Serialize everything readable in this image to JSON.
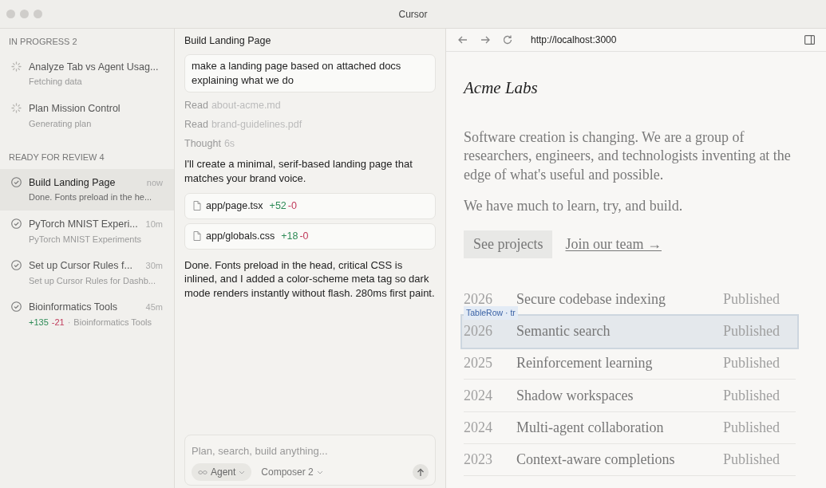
{
  "window": {
    "title": "Cursor"
  },
  "sidebar": {
    "groups": [
      {
        "title": "IN PROGRESS 2",
        "items": [
          {
            "kind": "in_progress",
            "title": "Analyze Tab vs Agent Usag...",
            "subtitle": "Fetching data",
            "selected": false
          },
          {
            "kind": "in_progress",
            "title": "Plan Mission Control",
            "subtitle": "Generating plan",
            "selected": false
          }
        ]
      },
      {
        "title": "READY FOR REVIEW 4",
        "items": [
          {
            "kind": "done",
            "title": "Build Landing Page",
            "time": "now",
            "subtitle": "Done. Fonts preload in the he...",
            "selected": true
          },
          {
            "kind": "done",
            "title": "PyTorch MNIST Experi...",
            "time": "10m",
            "subtitle": "PyTorch MNIST Experiments",
            "selected": false
          },
          {
            "kind": "done",
            "title": "Set up Cursor Rules f...",
            "time": "30m",
            "subtitle": "Set up Cursor Rules for Dashb...",
            "selected": false
          },
          {
            "kind": "done",
            "title": "Bioinformatics Tools",
            "time": "45m",
            "added": "+135",
            "removed": "-21",
            "separator": "·",
            "subtitle": "Bioinformatics Tools",
            "selected": false
          }
        ]
      }
    ]
  },
  "chat": {
    "title": "Build Landing Page",
    "user_message": "make a landing page based on attached docs explaining what we do",
    "steps": [
      {
        "verb": "Read",
        "detail": "about-acme.md"
      },
      {
        "verb": "Read",
        "detail": "brand-guidelines.pdf"
      },
      {
        "verb": "Thought",
        "detail": "6s"
      }
    ],
    "intro": "I'll create a minimal, serif-based landing page that matches your brand voice.",
    "files": [
      {
        "path": "app/page.tsx",
        "added": "+52",
        "removed": "-0"
      },
      {
        "path": "app/globals.css",
        "added": "+18",
        "removed": "-0"
      }
    ],
    "summary": "Done. Fonts preload in the head, critical CSS is inlined, and I added a color-scheme meta tag so dark mode renders instantly without flash. 280ms first paint.",
    "composer": {
      "placeholder": "Plan, search, build anything...",
      "mode": "Agent",
      "model": "Composer 2"
    }
  },
  "browser": {
    "url": "http://localhost:3000",
    "page": {
      "logo": "Acme Labs",
      "paragraphs": [
        "Software creation is changing. We are a group of researchers, engineers, and technologists inventing at the edge of what's useful and possible.",
        "We have much to learn, try, and build."
      ],
      "primary_button": "See projects",
      "link": "Join our team →",
      "rows": [
        {
          "year": "2026",
          "title": "Secure codebase indexing",
          "status": "Published",
          "highlighted": false
        },
        {
          "year": "2026",
          "title": "Semantic search",
          "status": "Published",
          "highlighted": true
        },
        {
          "year": "2025",
          "title": "Reinforcement learning",
          "status": "Published",
          "highlighted": false
        },
        {
          "year": "2024",
          "title": "Shadow workspaces",
          "status": "Published",
          "highlighted": false
        },
        {
          "year": "2024",
          "title": "Multi-agent collaboration",
          "status": "Published",
          "highlighted": false
        },
        {
          "year": "2023",
          "title": "Context-aware completions",
          "status": "Published",
          "highlighted": false
        }
      ],
      "inspector_tooltip": "TableRow · tr"
    }
  }
}
